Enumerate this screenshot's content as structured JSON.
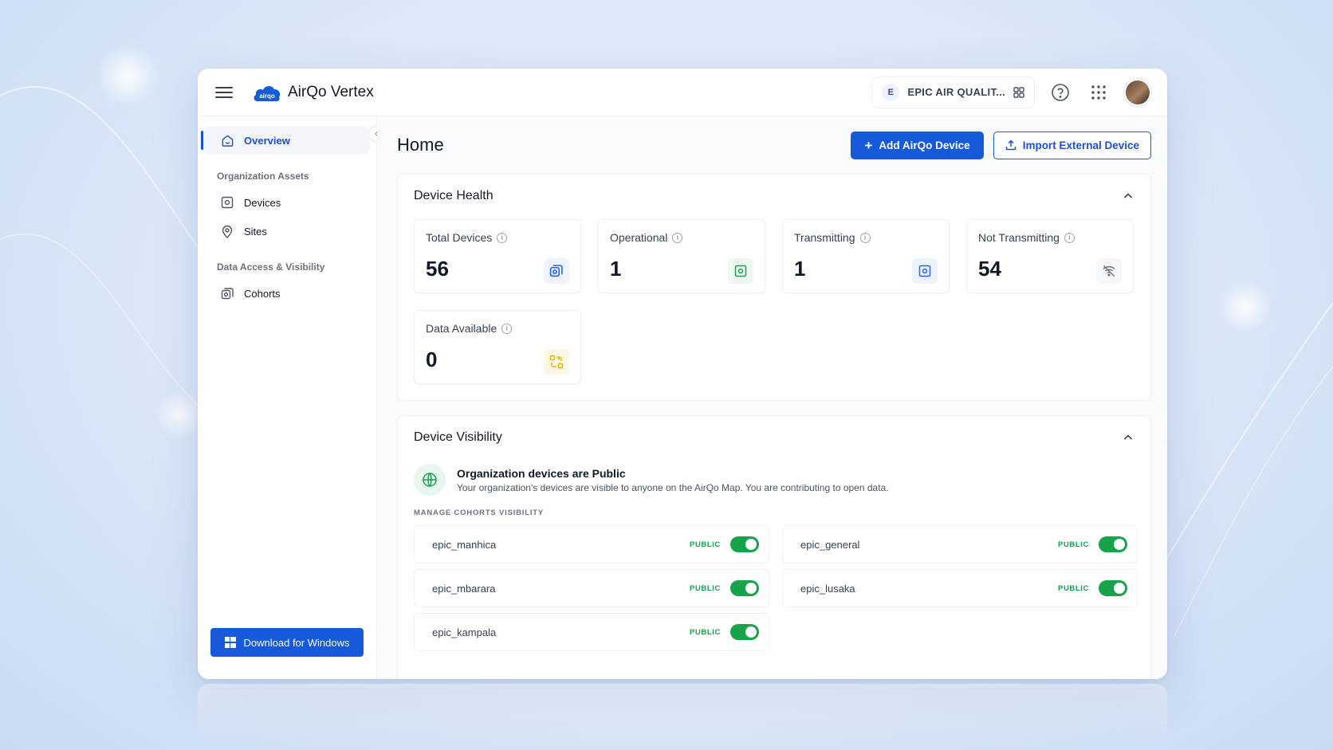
{
  "app": {
    "title": "AirQo Vertex",
    "logo_text": "airqo"
  },
  "topbar": {
    "org_initial": "E",
    "org_name": "EPIC AIR QUALIT..."
  },
  "sidebar": {
    "items": [
      {
        "label": "Overview",
        "icon": "home-icon",
        "active": true
      }
    ],
    "sections": [
      {
        "title": "Organization Assets",
        "items": [
          {
            "label": "Devices",
            "icon": "device-icon"
          },
          {
            "label": "Sites",
            "icon": "map-pin-icon"
          }
        ]
      },
      {
        "title": "Data Access & Visibility",
        "items": [
          {
            "label": "Cohorts",
            "icon": "cohorts-icon"
          }
        ]
      }
    ],
    "download_label": "Download for Windows"
  },
  "main": {
    "title": "Home",
    "add_device_label": "Add AirQo Device",
    "import_device_label": "Import External Device"
  },
  "device_health": {
    "title": "Device Health",
    "stats": [
      {
        "label": "Total Devices",
        "value": "56",
        "icon": "devices-stack-icon",
        "color": "#2563eb"
      },
      {
        "label": "Operational",
        "value": "1",
        "icon": "device-icon",
        "color": "#16a34a"
      },
      {
        "label": "Transmitting",
        "value": "1",
        "icon": "device-icon",
        "color": "#2563eb"
      },
      {
        "label": "Not Transmitting",
        "value": "54",
        "icon": "wifi-off-icon",
        "color": "#6b7280"
      },
      {
        "label": "Data Available",
        "value": "0",
        "icon": "data-icon",
        "color": "#eab308"
      }
    ]
  },
  "device_visibility": {
    "title": "Device Visibility",
    "status_title": "Organization devices are Public",
    "status_desc": "Your organization's devices are visible to anyone on the AirQo Map. You are contributing to open data.",
    "manage_label": "MANAGE COHORTS VISIBILITY",
    "cohorts": [
      {
        "name": "epic_manhica",
        "badge": "PUBLIC",
        "enabled": true
      },
      {
        "name": "epic_general",
        "badge": "PUBLIC",
        "enabled": true
      },
      {
        "name": "epic_mbarara",
        "badge": "PUBLIC",
        "enabled": true
      },
      {
        "name": "epic_lusaka",
        "badge": "PUBLIC",
        "enabled": true
      },
      {
        "name": "epic_kampala",
        "badge": "PUBLIC",
        "enabled": true
      }
    ]
  },
  "colors": {
    "primary": "#1659d9",
    "success": "#16a34a"
  }
}
